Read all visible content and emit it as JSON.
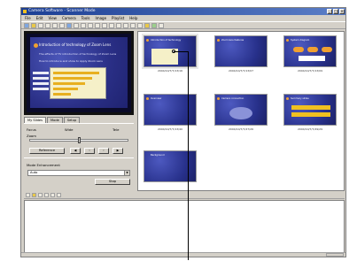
{
  "window": {
    "title": "Camera Software - Scanner Mode",
    "controls": [
      "_",
      "□",
      "×"
    ]
  },
  "menu": [
    "File",
    "Edit",
    "View",
    "Camera",
    "Tools",
    "Image",
    "Playlist",
    "Help"
  ],
  "preview": {
    "title": "Introduction of technology of Zoom Lens",
    "bullets": [
      "The effects of TV introduction of technology of Zoom Lens",
      "How to introduce and show to Apply Zoom Lens"
    ]
  },
  "tabs": [
    "My Slides",
    "Mode",
    "Setup"
  ],
  "controls": {
    "focus_label": "Focus",
    "focus_value": "Wide",
    "tele_label": "Tele",
    "zoom_label": "Zoom",
    "reference_button": "Reference",
    "mode_label": "Mode Enhancement",
    "mode_value": "Auto",
    "stop_button": "Stop"
  },
  "thumbnails": [
    {
      "title": "Introduction of technology",
      "caption": "2004/10/7/7/13/16"
    },
    {
      "title": "Zoom lens features",
      "caption": "2004/10/7/7/13/07"
    },
    {
      "title": "System diagram",
      "caption": "2004/10/7/7/13/09"
    },
    {
      "title": "Overview",
      "caption": "2004/10/7/7/13/40"
    },
    {
      "title": "Camera connection",
      "caption": "2004/10/7/7/27/26"
    },
    {
      "title": "Summary slides",
      "caption": "2004/10/7/7/29/29"
    },
    {
      "title": "Background",
      "caption": ""
    }
  ],
  "colors": {
    "slide_bg": "#27308a",
    "accent": "#f0a030",
    "chart_bg": "#f5f0c8"
  }
}
